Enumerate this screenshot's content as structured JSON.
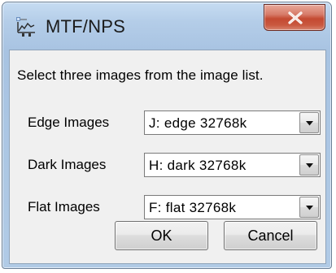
{
  "window": {
    "title": "MTF/NPS",
    "icon": "image-analysis-icon",
    "close_icon": "close-icon",
    "colors": {
      "title_bar": "#b4cde8",
      "close_button": "#c44a32",
      "client_background": "#f0f0f0"
    }
  },
  "dialog": {
    "instruction": "Select three images from the image list.",
    "rows": [
      {
        "label": "Edge Images",
        "selected": "J: edge  32768k"
      },
      {
        "label": "Dark Images",
        "selected": "H: dark  32768k"
      },
      {
        "label": "Flat Images",
        "selected": "F: flat  32768k"
      }
    ],
    "buttons": {
      "ok": "OK",
      "cancel": "Cancel"
    }
  }
}
